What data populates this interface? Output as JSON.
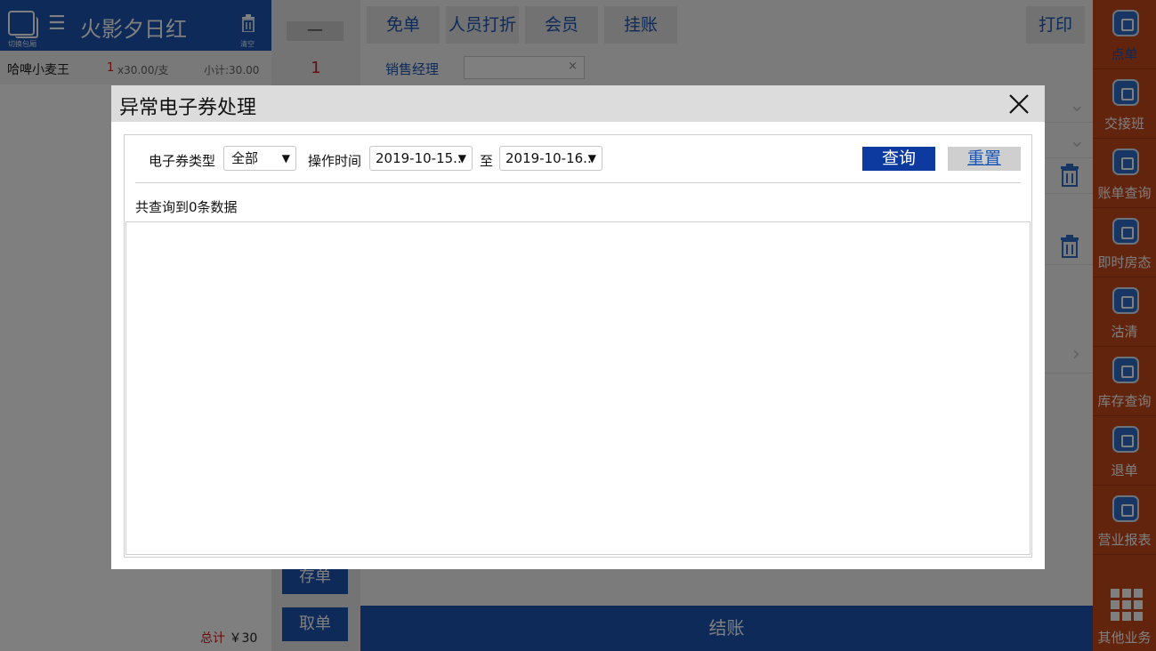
{
  "left": {
    "switch_label": "切换包厢",
    "room_icon": "☰",
    "room_name": "火影夕日红",
    "clear_label": "清空",
    "order": {
      "name": "哈啤小麦王",
      "qty": "1",
      "price": "x30.00/支",
      "subtotal": "小计:30.00"
    },
    "total_label": "总计",
    "total_value": "￥30"
  },
  "middle": {
    "minus": "—",
    "qty": "1",
    "save_order": "存单",
    "take_order": "取单"
  },
  "main": {
    "tabs": [
      "免单",
      "人员打折",
      "会员",
      "挂账",
      "打印"
    ],
    "sales_label": "销售经理",
    "sales_clear": "×",
    "checkout": "结账"
  },
  "right_nav": {
    "items": [
      "点单",
      "交接班",
      "账单查询",
      "即时房态",
      "沽清",
      "库存查询",
      "退单",
      "营业报表"
    ],
    "other": "其他业务"
  },
  "dialog": {
    "title": "异常电子券处理",
    "coupon_type_label": "电子券类型",
    "coupon_type_value": "全部",
    "op_time_label": "操作时间",
    "date_from": "2019-10-15..",
    "to_label": "至",
    "date_to": "2019-10-16..",
    "query_button": "查询",
    "reset_button": "重置",
    "count_text": "共查询到0条数据"
  },
  "colors": {
    "brand_blue": "#1a55b3",
    "query_blue": "#0d3a9e",
    "nav_orange": "#c6491d",
    "accent_red": "#d01c1c"
  }
}
